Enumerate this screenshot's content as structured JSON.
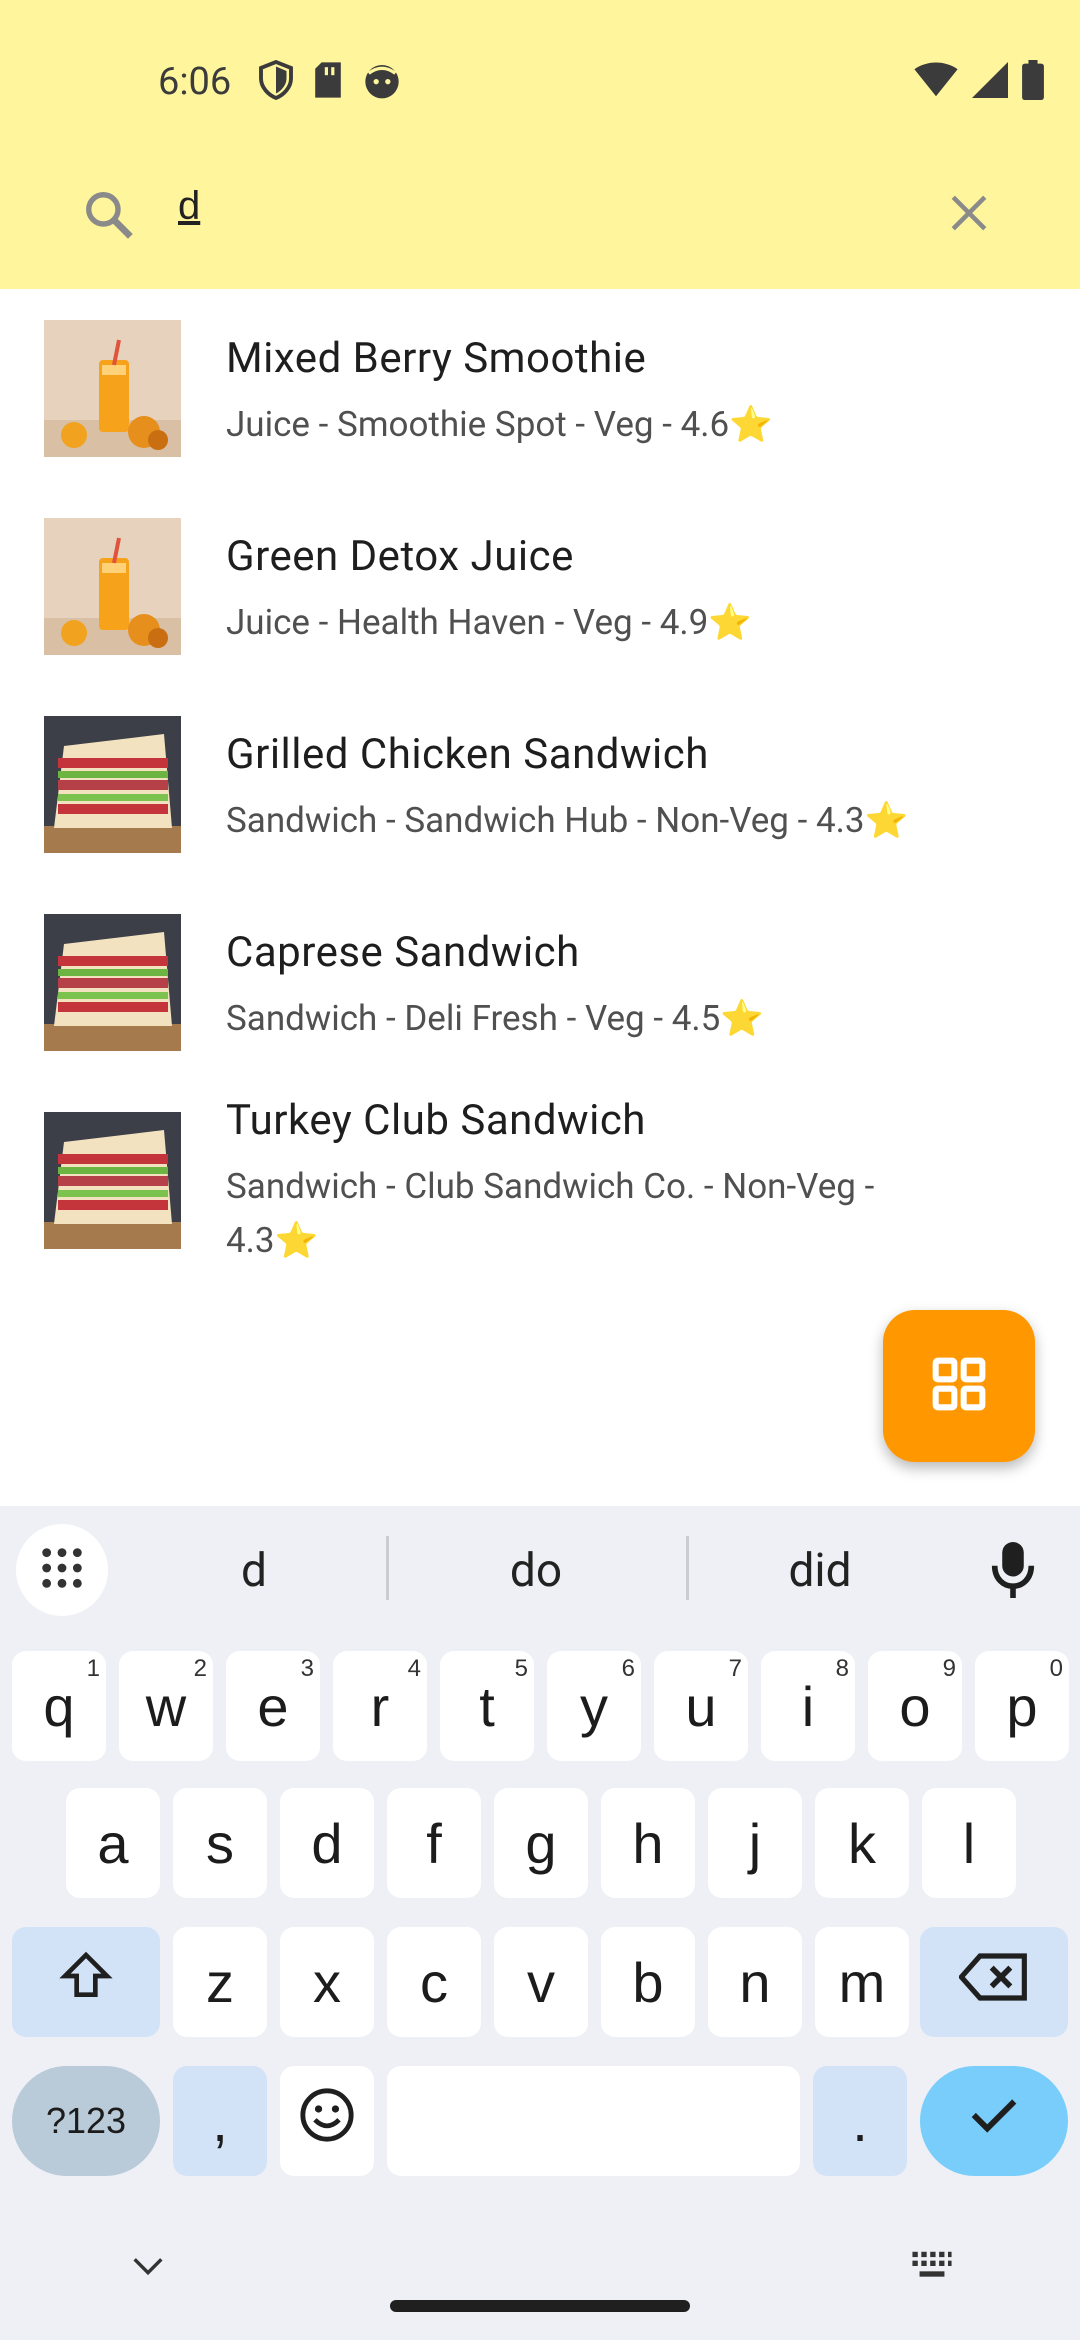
{
  "status_bar": {
    "time": "6:06"
  },
  "search": {
    "query": "d"
  },
  "results": [
    {
      "name": "Mixed Berry Smoothie",
      "details": "Juice - Smoothie Spot - Veg - 4.6",
      "thumb": "juice"
    },
    {
      "name": "Green Detox Juice",
      "details": "Juice - Health Haven - Veg - 4.9",
      "thumb": "juice"
    },
    {
      "name": "Grilled Chicken Sandwich",
      "details": "Sandwich - Sandwich Hub - Non-Veg - 4.3",
      "thumb": "sandwich"
    },
    {
      "name": "Caprese Sandwich",
      "details": "Sandwich - Deli Fresh - Veg - 4.5",
      "thumb": "sandwich"
    },
    {
      "name": "Turkey Club Sandwich",
      "details_line1": "Sandwich - Club Sandwich Co. - Non-Veg -",
      "details_line2": "4.3",
      "thumb": "sandwich"
    }
  ],
  "rating_icon": "⭐",
  "fab": {
    "icon": "grid-icon",
    "color": "#ff9800"
  },
  "keyboard": {
    "suggestions": [
      "d",
      "do",
      "did"
    ],
    "row1": [
      [
        "q",
        "1"
      ],
      [
        "w",
        "2"
      ],
      [
        "e",
        "3"
      ],
      [
        "r",
        "4"
      ],
      [
        "t",
        "5"
      ],
      [
        "y",
        "6"
      ],
      [
        "u",
        "7"
      ],
      [
        "i",
        "8"
      ],
      [
        "o",
        "9"
      ],
      [
        "p",
        "0"
      ]
    ],
    "row2": [
      "a",
      "s",
      "d",
      "f",
      "g",
      "h",
      "j",
      "k",
      "l"
    ],
    "row3": [
      "z",
      "x",
      "c",
      "v",
      "b",
      "n",
      "m"
    ],
    "symbols_label": "?123",
    "comma": ",",
    "period": "."
  }
}
